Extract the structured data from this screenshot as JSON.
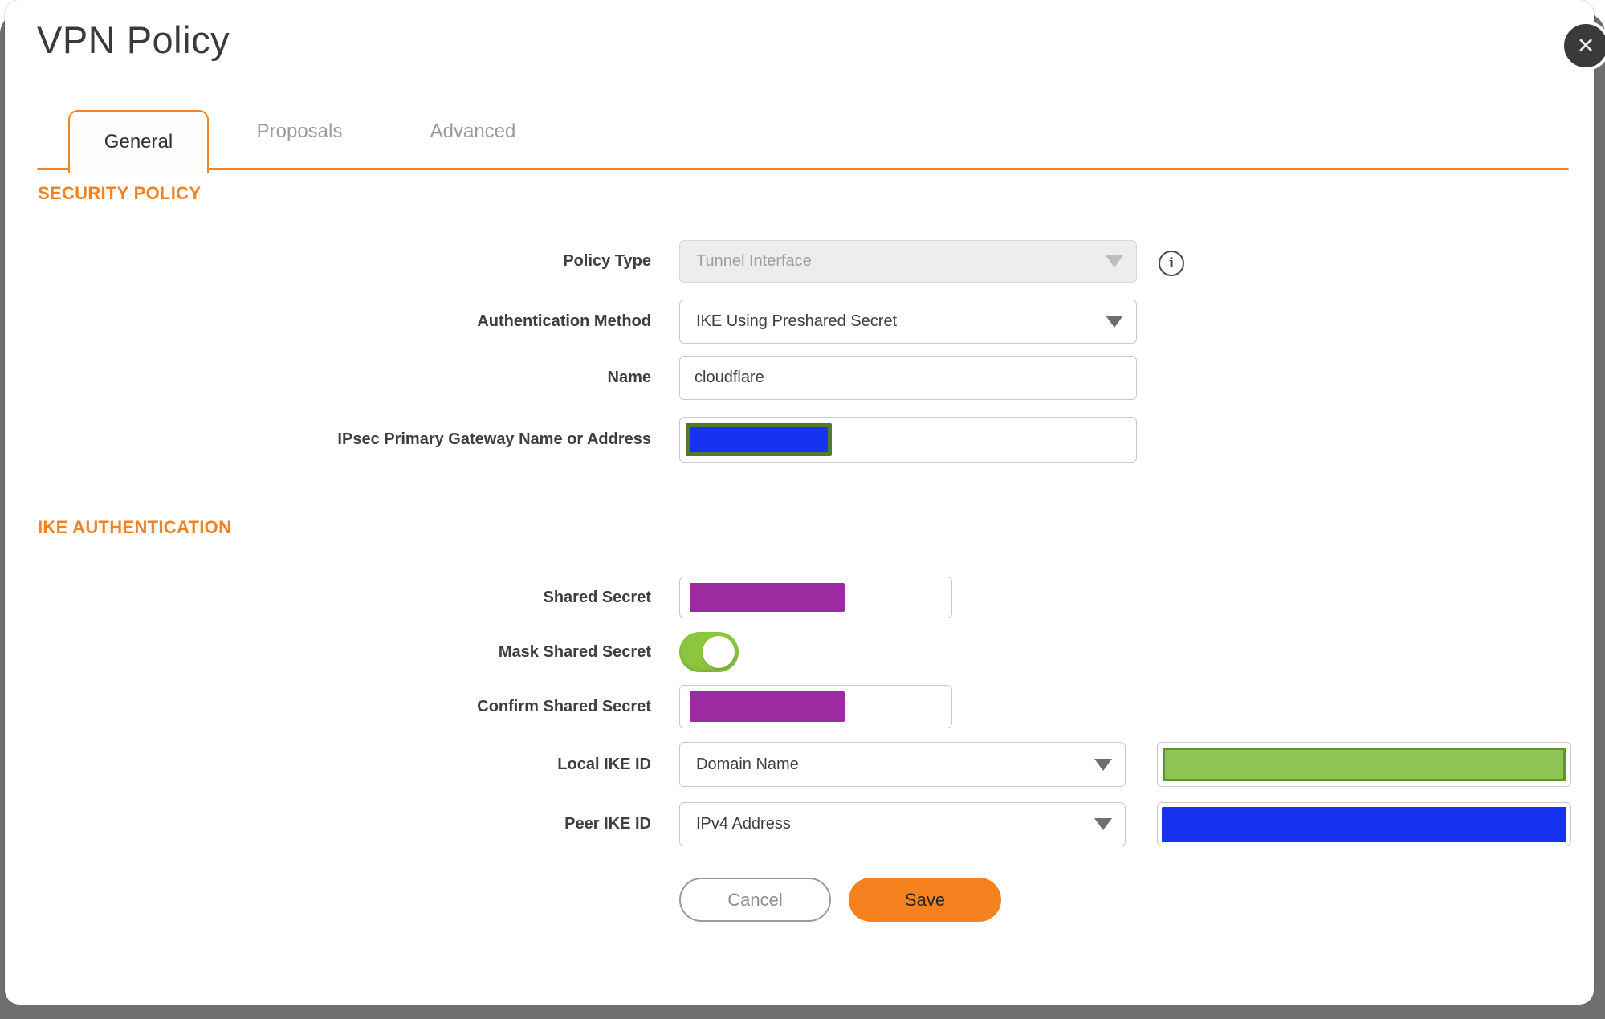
{
  "colors": {
    "accent_orange": "#F6821F",
    "page_bg": "#6F6F6F",
    "text_dark": "#3C3C3C",
    "text_muted": "#9B9B9B",
    "toggle_green": "#8CC63F",
    "redact_purple": "#9C2AA0",
    "redact_blue": "#1733F0",
    "redact_green_fill": "#8CC456",
    "redact_green_border": "#63942F",
    "redact_olive_border": "#527A28"
  },
  "dialog": {
    "title": "VPN Policy",
    "close_glyph": "✕"
  },
  "tabs": [
    {
      "label": "General",
      "active": true
    },
    {
      "label": "Proposals",
      "active": false
    },
    {
      "label": "Advanced",
      "active": false
    }
  ],
  "security_policy": {
    "heading": "SECURITY POLICY",
    "policy_type": {
      "label": "Policy Type",
      "value": "Tunnel Interface",
      "disabled": true,
      "info_glyph": "i"
    },
    "auth_method": {
      "label": "Authentication Method",
      "value": "IKE Using Preshared Secret"
    },
    "name": {
      "label": "Name",
      "value": "cloudflare"
    },
    "gateway": {
      "label": "IPsec Primary Gateway Name or Address",
      "value_redacted": true,
      "redaction_color": "blue"
    }
  },
  "ike_authentication": {
    "heading": "IKE AUTHENTICATION",
    "shared_secret": {
      "label": "Shared Secret",
      "value_redacted": true,
      "redaction_color": "purple"
    },
    "mask_shared_secret": {
      "label": "Mask Shared Secret",
      "enabled": true
    },
    "confirm_shared_secret": {
      "label": "Confirm Shared Secret",
      "value_redacted": true,
      "redaction_color": "purple"
    },
    "local_ike_id": {
      "label": "Local IKE ID",
      "value": "Domain Name",
      "id_value_redacted": true,
      "redaction_color": "green"
    },
    "peer_ike_id": {
      "label": "Peer IKE ID",
      "value": "IPv4 Address",
      "id_value_redacted": true,
      "redaction_color": "blue"
    }
  },
  "actions": {
    "cancel": "Cancel",
    "save": "Save"
  }
}
